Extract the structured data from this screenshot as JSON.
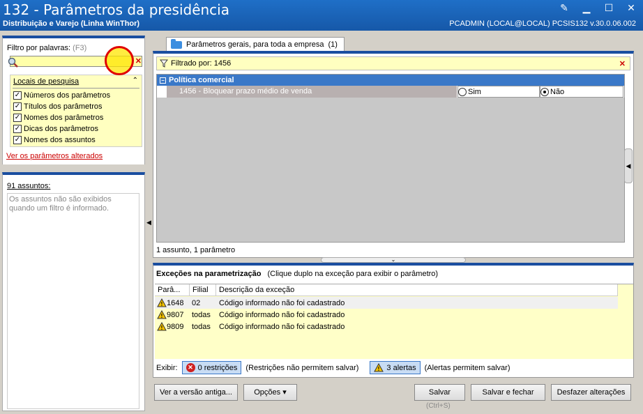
{
  "window": {
    "title": "132 - Parâmetros da presidência",
    "subtitle": "Distribuição e Varejo (Linha WinThor)",
    "user_info": "PCADMIN (LOCAL@LOCAL)   PCSIS132  v.30.0.06.002"
  },
  "filter": {
    "label": "Filtro por palavras:",
    "shortcut": "(F3)",
    "value": "",
    "locais_title": "Locais de pesquisa",
    "options": [
      {
        "label": "Números dos parâmetros",
        "checked": true
      },
      {
        "label": "Títulos dos parâmetros",
        "checked": true
      },
      {
        "label": "Nomes dos parâmetros",
        "checked": true
      },
      {
        "label": "Dicas dos parâmetros",
        "checked": true
      },
      {
        "label": "Nomes dos assuntos",
        "checked": true
      }
    ],
    "changed_link": "Ver os parâmetros alterados"
  },
  "subjects": {
    "count_label": "91 assuntos:",
    "message": "Os assuntos não são exibidos quando um filtro é informado."
  },
  "tab": {
    "label": "Parâmetros gerais, para toda a empresa",
    "count": "(1)"
  },
  "params": {
    "filtered_label": "Filtrado por: 1456",
    "group_title": "Política comercial",
    "row_label": "1456 - Bloquear prazo médio de venda",
    "option_yes": "Sim",
    "option_no": "Não",
    "selected": "Não",
    "status": "1 assunto, 1 parâmetro"
  },
  "exceptions": {
    "title": "Exceções na parametrização",
    "hint": "(Clique duplo na exceção para exibir o parâmetro)",
    "columns": [
      "Parâ...",
      "Filial",
      "Descrição da exceção"
    ],
    "rows": [
      {
        "param": "1648",
        "filial": "02",
        "desc": "Código informado não foi cadastrado"
      },
      {
        "param": "9807",
        "filial": "todas",
        "desc": "Código informado não foi cadastrado"
      },
      {
        "param": "9809",
        "filial": "todas",
        "desc": "Código informado não foi cadastrado"
      }
    ],
    "show_label": "Exibir:",
    "restrictions_badge": "0 restrições",
    "restrictions_note": "(Restrições não permitem salvar)",
    "alerts_badge": "3 alertas",
    "alerts_note": "(Alertas permitem salvar)"
  },
  "buttons": {
    "old_version": "Ver a versão antiga...",
    "options": "Opções ▾",
    "save": "Salvar",
    "save_shortcut": "(Ctrl+S)",
    "save_close": "Salvar e fechar",
    "undo": "Desfazer alterações"
  },
  "colors": {
    "accent": "#1a4ea0",
    "title_bar": "#1f6fc7",
    "highlight": "#ffffc0",
    "error": "#cc0000"
  }
}
